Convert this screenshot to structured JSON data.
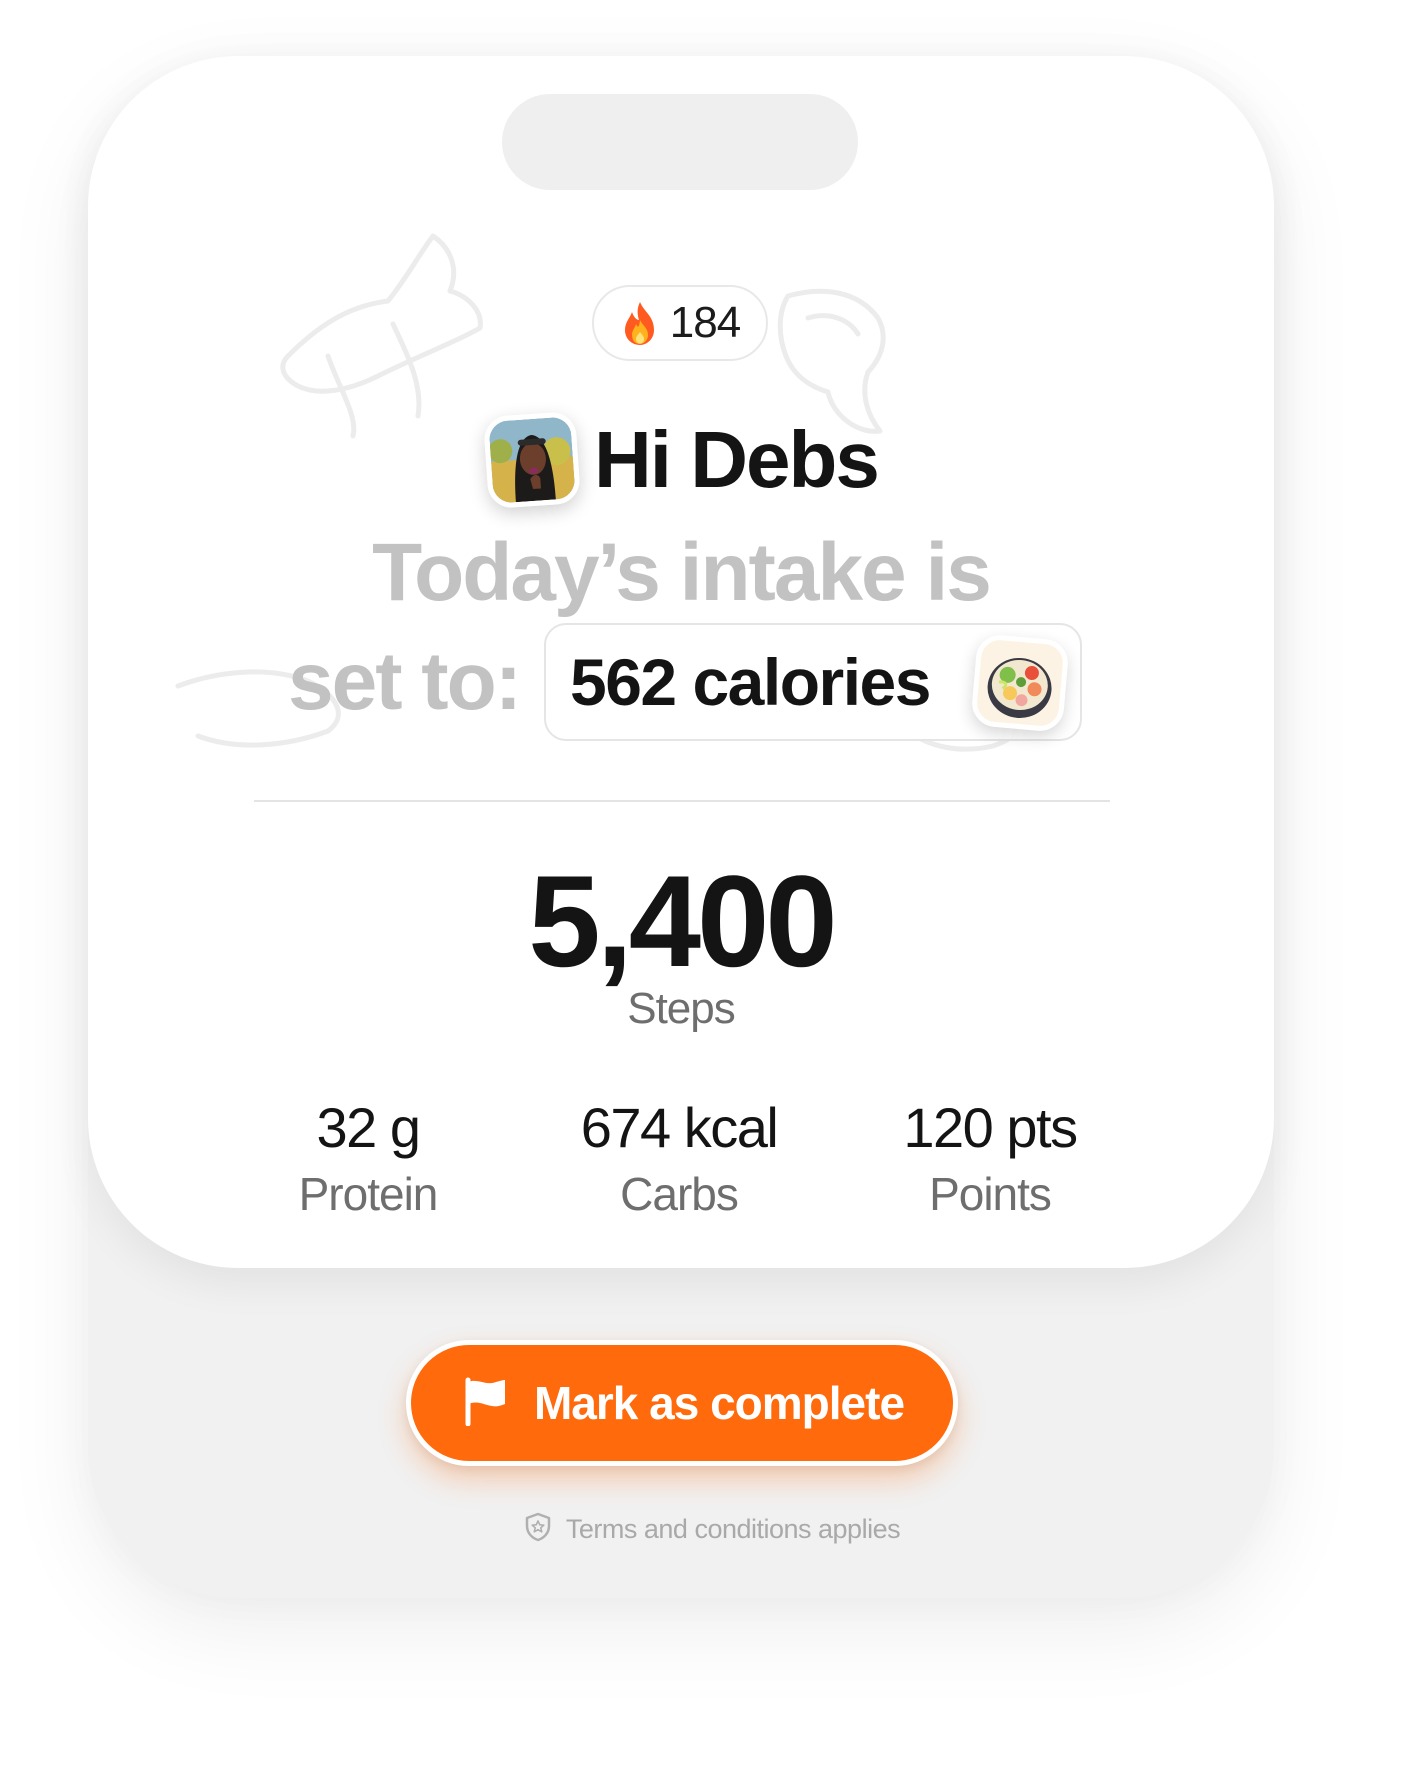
{
  "streak": {
    "icon": "fire-icon",
    "count": "184"
  },
  "greeting": {
    "text": "Hi Debs",
    "avatar": "user-avatar"
  },
  "intake": {
    "line1": "Today’s intake is",
    "prefix": "set to:",
    "value": "562 calories",
    "icon": "food-bowl-icon"
  },
  "steps": {
    "value": "5,400",
    "label": "Steps"
  },
  "stats": [
    {
      "value": "32 g",
      "label": "Protein"
    },
    {
      "value": "674 kcal",
      "label": "Carbs"
    },
    {
      "value": "120 pts",
      "label": "Points"
    }
  ],
  "cta": {
    "label": "Mark as complete",
    "icon": "flag-icon",
    "color": "#ff6a0c"
  },
  "terms": {
    "text": "Terms and conditions applies",
    "icon": "shield-icon"
  }
}
